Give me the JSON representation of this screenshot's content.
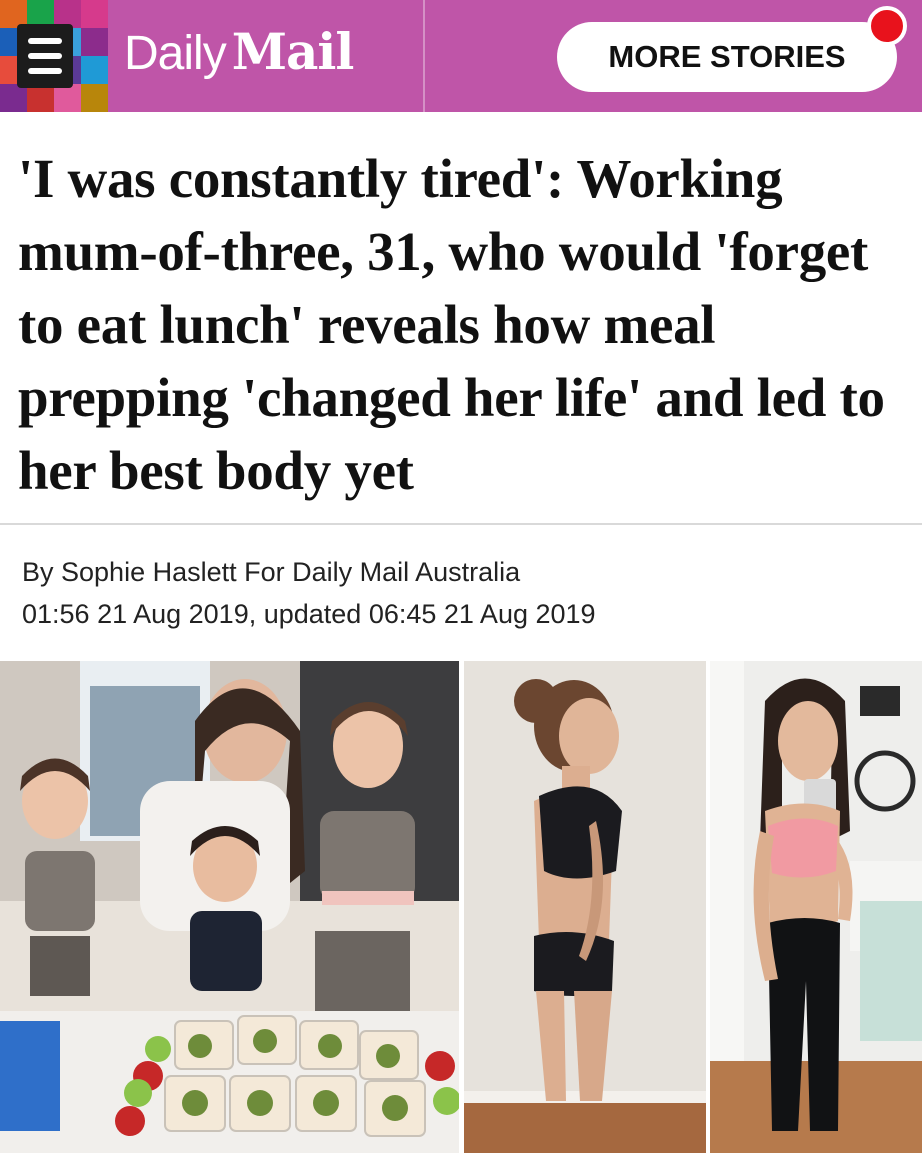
{
  "header": {
    "brand_daily": "Daily",
    "brand_mail": "Mail",
    "more_stories_label": "MORE STORIES",
    "background_color": "#bf55a8",
    "menu_icon": "hamburger-menu-icon",
    "notification_color": "#e8121c"
  },
  "article": {
    "headline": "'I was constantly tired': Working mum-of-three, 31, who would 'forget to eat lunch' reveals how meal prepping 'changed her life' and led to her best body yet",
    "byline": "By Sophie Haslett For Daily Mail Australia",
    "dateline": "01:56 21 Aug 2019, updated 06:45 21 Aug 2019"
  },
  "photos": [
    {
      "subject": "family-with-meal-prep-photo"
    },
    {
      "subject": "side-profile-before-photo"
    },
    {
      "subject": "mirror-selfie-after-photo"
    }
  ],
  "menu_grid_colors": [
    "#e0651f",
    "#19a34a",
    "#b8328a",
    "#d63a8c",
    "#1b5fb8",
    "#f3a41a",
    "#3aa0dc",
    "#8c2c8c",
    "#e74c3c",
    "#2a62b5",
    "#5b3a97",
    "#1f9ad6",
    "#7a2b8f",
    "#c8312f",
    "#e05a9c",
    "#b8860b"
  ]
}
